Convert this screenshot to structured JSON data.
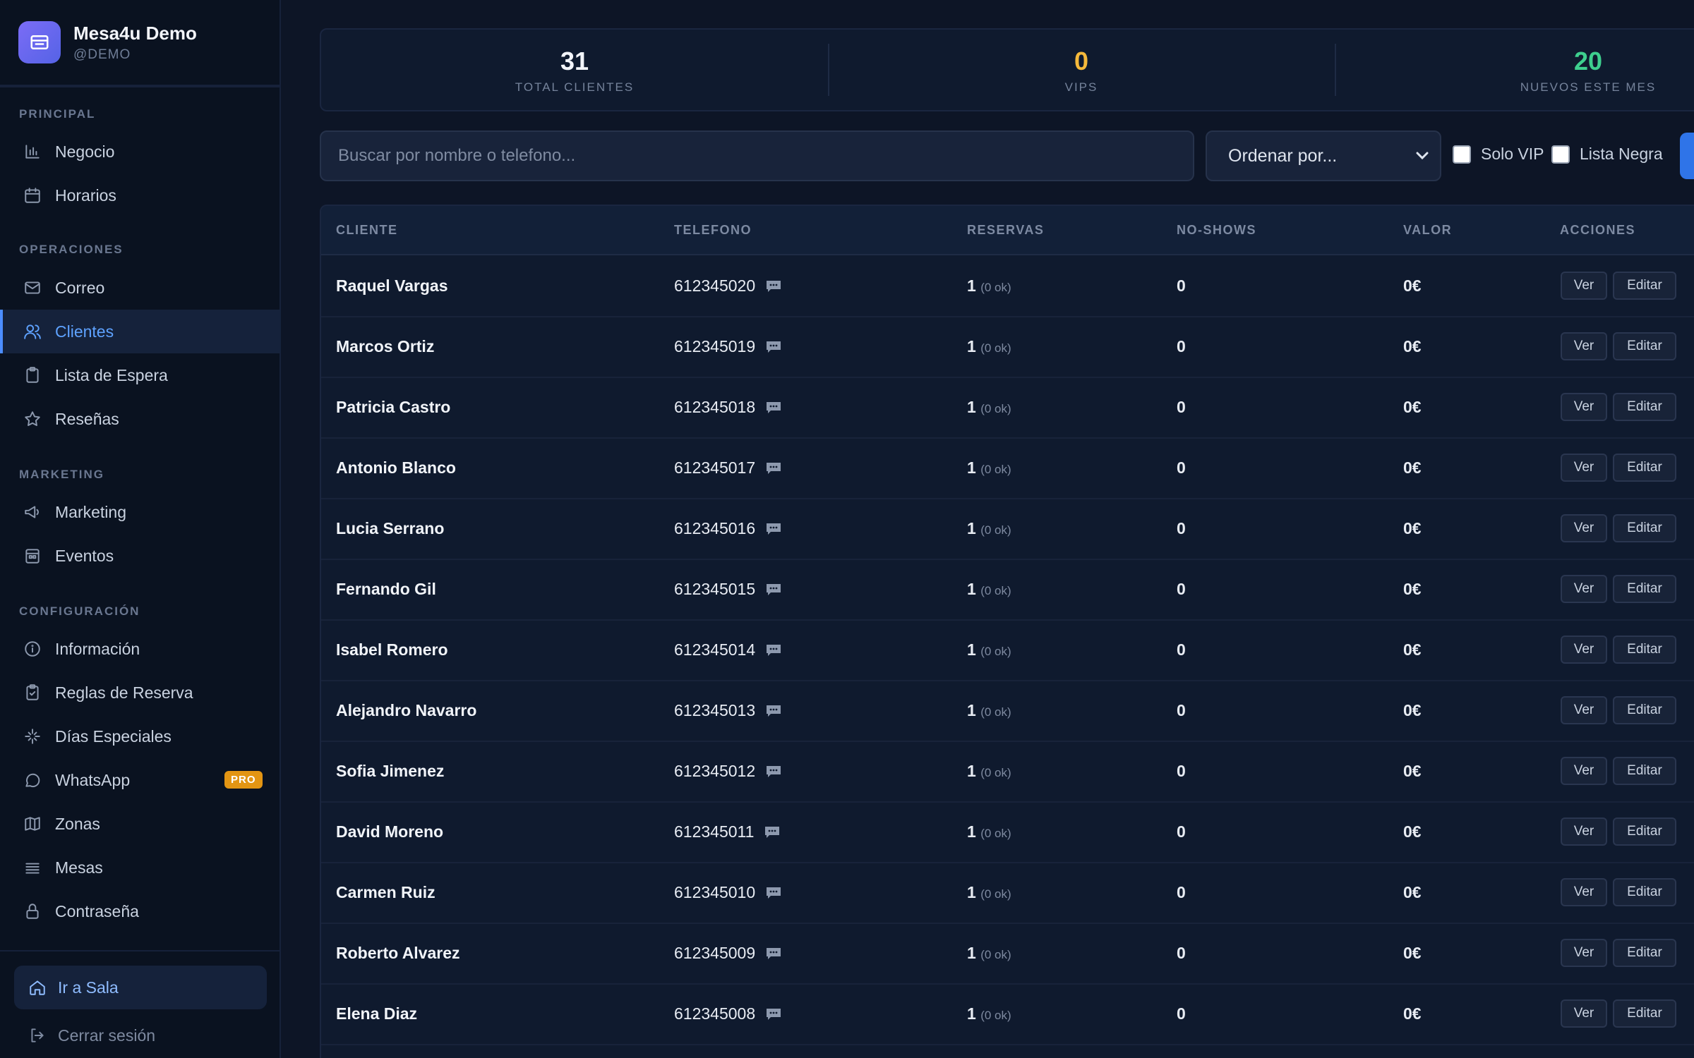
{
  "brand": {
    "name": "Mesa4u Demo",
    "handle": "@DEMO"
  },
  "sidebar": {
    "sections": [
      {
        "title": "PRINCIPAL"
      },
      {
        "title": "OPERACIONES"
      },
      {
        "title": "MARKETING"
      },
      {
        "title": "CONFIGURACIÓN"
      }
    ],
    "items": [
      {
        "label": "Negocio",
        "icon": "chart-icon"
      },
      {
        "label": "Horarios",
        "icon": "calendar-icon"
      },
      {
        "label": "Correo",
        "icon": "mail-icon"
      },
      {
        "label": "Clientes",
        "icon": "users-icon",
        "active": true
      },
      {
        "label": "Lista de Espera",
        "icon": "clipboard-icon"
      },
      {
        "label": "Reseñas",
        "icon": "star-icon"
      },
      {
        "label": "Marketing",
        "icon": "megaphone-icon"
      },
      {
        "label": "Eventos",
        "icon": "event-calendar-icon"
      },
      {
        "label": "Información",
        "icon": "info-icon"
      },
      {
        "label": "Reglas de Reserva",
        "icon": "clipboard-check-icon"
      },
      {
        "label": "Días Especiales",
        "icon": "sparkle-icon"
      },
      {
        "label": "WhatsApp",
        "icon": "chat-icon",
        "badge": "PRO"
      },
      {
        "label": "Zonas",
        "icon": "map-icon"
      },
      {
        "label": "Mesas",
        "icon": "list-icon"
      },
      {
        "label": "Contraseña",
        "icon": "lock-icon"
      }
    ],
    "footer": {
      "ir_sala": "Ir a Sala",
      "logout": "Cerrar sesión"
    }
  },
  "stats": [
    {
      "value": "31",
      "label": "TOTAL CLIENTES",
      "color": "#f3f5fa"
    },
    {
      "value": "0",
      "label": "VIPS",
      "color": "#f5b93b"
    },
    {
      "value": "20",
      "label": "NUEVOS ESTE MES",
      "color": "#3ecf8e"
    }
  ],
  "filters": {
    "search_placeholder": "Buscar por nombre o telefono...",
    "sort_label": "Ordenar por...",
    "solo_vip": "Solo VIP",
    "lista_negra": "Lista Negra"
  },
  "table": {
    "headers": [
      "CLIENTE",
      "TELEFONO",
      "RESERVAS",
      "NO-SHOWS",
      "VALOR",
      "ACCIONES"
    ],
    "actions": {
      "view": "Ver",
      "edit": "Editar"
    },
    "rows": [
      {
        "name": "Raquel Vargas",
        "phone": "612345020",
        "reservas": "1",
        "ok": "(0 ok)",
        "noshows": "0",
        "valor": "0€"
      },
      {
        "name": "Marcos Ortiz",
        "phone": "612345019",
        "reservas": "1",
        "ok": "(0 ok)",
        "noshows": "0",
        "valor": "0€"
      },
      {
        "name": "Patricia Castro",
        "phone": "612345018",
        "reservas": "1",
        "ok": "(0 ok)",
        "noshows": "0",
        "valor": "0€"
      },
      {
        "name": "Antonio Blanco",
        "phone": "612345017",
        "reservas": "1",
        "ok": "(0 ok)",
        "noshows": "0",
        "valor": "0€"
      },
      {
        "name": "Lucia Serrano",
        "phone": "612345016",
        "reservas": "1",
        "ok": "(0 ok)",
        "noshows": "0",
        "valor": "0€"
      },
      {
        "name": "Fernando Gil",
        "phone": "612345015",
        "reservas": "1",
        "ok": "(0 ok)",
        "noshows": "0",
        "valor": "0€"
      },
      {
        "name": "Isabel Romero",
        "phone": "612345014",
        "reservas": "1",
        "ok": "(0 ok)",
        "noshows": "0",
        "valor": "0€"
      },
      {
        "name": "Alejandro Navarro",
        "phone": "612345013",
        "reservas": "1",
        "ok": "(0 ok)",
        "noshows": "0",
        "valor": "0€"
      },
      {
        "name": "Sofia Jimenez",
        "phone": "612345012",
        "reservas": "1",
        "ok": "(0 ok)",
        "noshows": "0",
        "valor": "0€"
      },
      {
        "name": "David Moreno",
        "phone": "612345011",
        "reservas": "1",
        "ok": "(0 ok)",
        "noshows": "0",
        "valor": "0€"
      },
      {
        "name": "Carmen Ruiz",
        "phone": "612345010",
        "reservas": "1",
        "ok": "(0 ok)",
        "noshows": "0",
        "valor": "0€"
      },
      {
        "name": "Roberto Alvarez",
        "phone": "612345009",
        "reservas": "1",
        "ok": "(0 ok)",
        "noshows": "0",
        "valor": "0€"
      },
      {
        "name": "Elena Diaz",
        "phone": "612345008",
        "reservas": "1",
        "ok": "(0 ok)",
        "noshows": "0",
        "valor": "0€"
      }
    ]
  }
}
